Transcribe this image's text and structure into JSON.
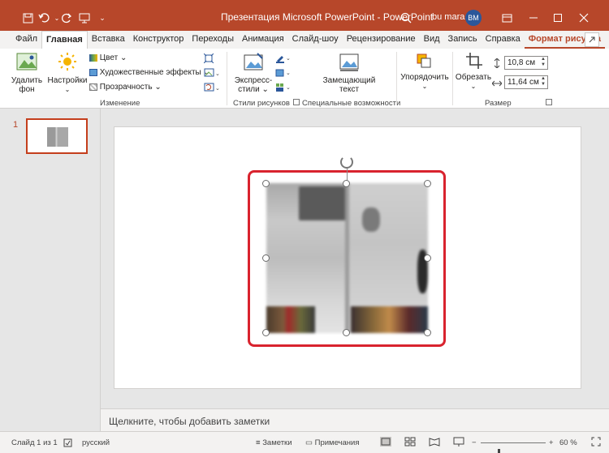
{
  "titlebar": {
    "title": "Презентация Microsoft PowerPoint  -  PowerPoint",
    "user": "bu mara",
    "avatar": "BM",
    "buttons": [
      "save-icon",
      "undo-icon",
      "redo-icon",
      "present-icon",
      "customize-icon",
      "search-icon",
      "ribbon-display-icon",
      "minimize-icon",
      "maximize-icon",
      "close-icon"
    ]
  },
  "tabs": [
    "Файл",
    "Главная",
    "Вставка",
    "Конструктор",
    "Переходы",
    "Анимация",
    "Слайд-шоу",
    "Рецензирование",
    "Вид",
    "Запись",
    "Справка",
    "Формат рисунка"
  ],
  "active_tab": "Главная",
  "ribbon": {
    "remove_bg": [
      "Удалить",
      "фон"
    ],
    "corrections": "Настройки",
    "color": "Цвет",
    "artistic": "Художественные эффекты",
    "transparency": "Прозрачность",
    "group_adjust": "Изменение",
    "quick_styles": [
      "Экспресс-",
      "стили"
    ],
    "group_styles": "Стили рисунков",
    "alt_text": [
      "Замещающий",
      "текст"
    ],
    "group_access": "Специальные возможности",
    "arrange": "Упорядочить",
    "crop": "Обрезать",
    "height": "10,8 см",
    "width": "11,64 см",
    "group_size": "Размер"
  },
  "slides_pane": {
    "slide_number": "1"
  },
  "notes": {
    "placeholder": "Щелкните, чтобы добавить заметки"
  },
  "status": {
    "slide": "Слайд 1 из 1",
    "language": "русский",
    "notes": "Заметки",
    "comments": "Примечания",
    "zoom": "60 %",
    "zoom_level": 60
  },
  "colors": {
    "accent": "#b7472a",
    "selection_outline": "#d9232e"
  }
}
